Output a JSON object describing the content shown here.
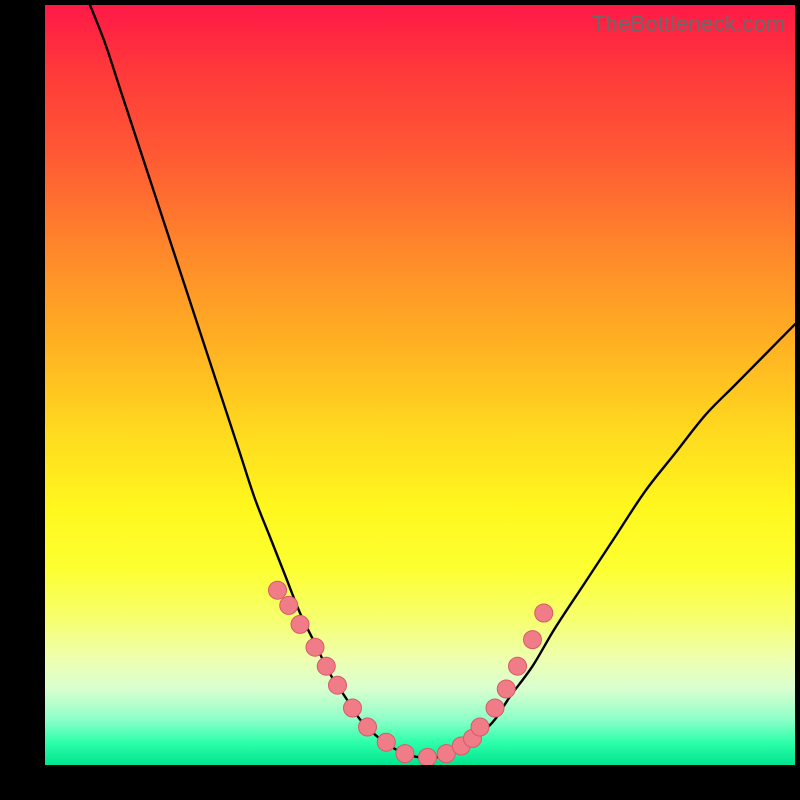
{
  "watermark": "TheBottleneck.com",
  "chart_data": {
    "type": "line",
    "title": "",
    "xlabel": "",
    "ylabel": "",
    "xlim": [
      0,
      100
    ],
    "ylim": [
      0,
      100
    ],
    "series": [
      {
        "name": "bottleneck-curve",
        "x": [
          6,
          8,
          10,
          12,
          14,
          16,
          18,
          20,
          22,
          24,
          26,
          28,
          30,
          32,
          34,
          36,
          38,
          40,
          42,
          44,
          46,
          48,
          50,
          52,
          54,
          56,
          58,
          60,
          62,
          65,
          68,
          72,
          76,
          80,
          84,
          88,
          92,
          96,
          100
        ],
        "y": [
          100,
          95,
          89,
          83,
          77,
          71,
          65,
          59,
          53,
          47,
          41,
          35,
          30,
          25,
          20,
          16,
          12,
          9,
          6,
          4,
          2.5,
          1.5,
          1,
          1,
          1.5,
          2.5,
          4,
          6,
          9,
          13,
          18,
          24,
          30,
          36,
          41,
          46,
          50,
          54,
          58
        ]
      }
    ],
    "points": {
      "name": "sample-points",
      "x": [
        31,
        32.5,
        34,
        36,
        37.5,
        39,
        41,
        43,
        45.5,
        48,
        51,
        53.5,
        55.5,
        57,
        58,
        60,
        61.5,
        63,
        65,
        66.5
      ],
      "y": [
        23,
        21,
        18.5,
        15.5,
        13,
        10.5,
        7.5,
        5,
        3,
        1.5,
        1,
        1.5,
        2.5,
        3.5,
        5,
        7.5,
        10,
        13,
        16.5,
        20
      ]
    },
    "colors": {
      "curve": "#000000",
      "points_fill": "#f07c87",
      "points_stroke": "#d85a68"
    }
  }
}
